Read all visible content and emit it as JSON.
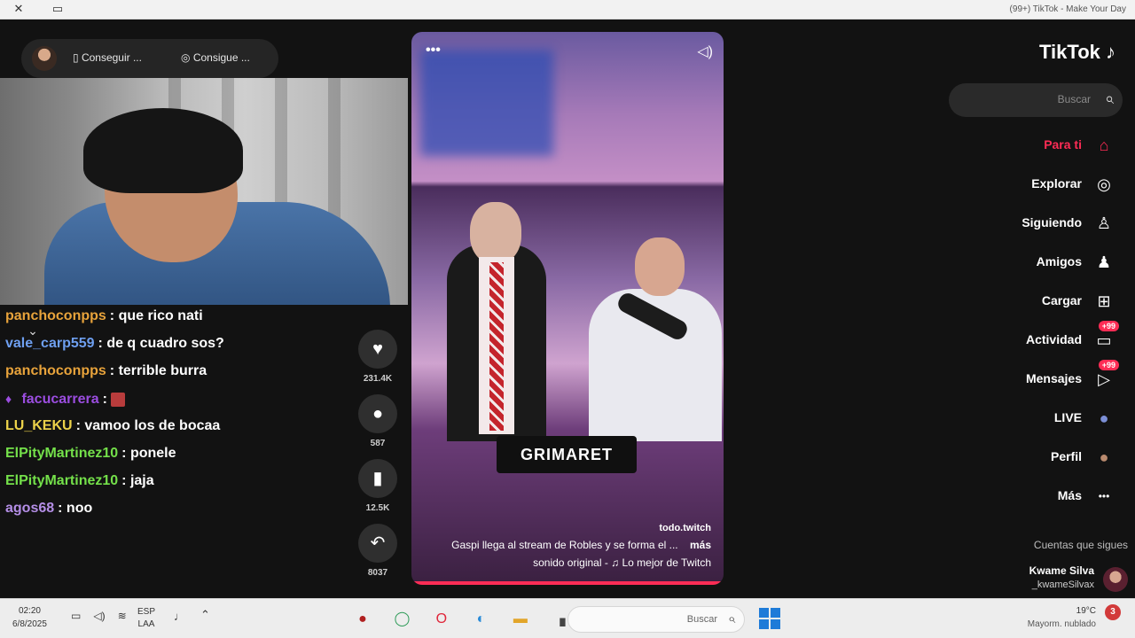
{
  "window": {
    "title": "(99+) TikTok - Make Your Day",
    "close": "✕",
    "restore": "▭"
  },
  "stream_bar": {
    "item1": "Consigue ...",
    "item2": "Conseguir ..."
  },
  "chat": [
    {
      "user": "panchoconpps",
      "color": "#e8a33b",
      "text": "que rico nati"
    },
    {
      "user": "vale_carp559",
      "color": "#6e9ff0",
      "text": "de q cuadro sos?"
    },
    {
      "user": "panchoconpps",
      "color": "#e8a33b",
      "text": "terrible burra"
    },
    {
      "user": "facucarrera",
      "color": "#9b4de0",
      "text": ""
    },
    {
      "user": "LU_KEKU",
      "color": "#ecd24a",
      "text": "vamoo los de bocaa"
    },
    {
      "user": "ElPityMartinez10",
      "color": "#74e04a",
      "text": "ponele"
    },
    {
      "user": "ElPityMartinez10",
      "color": "#74e04a",
      "text": "jaja"
    },
    {
      "user": "agos68",
      "color": "#b48ee6",
      "text": "noo"
    }
  ],
  "actions": {
    "likes": "231.4K",
    "comments": "587",
    "saves": "12.5K",
    "shares": "8037"
  },
  "video": {
    "brand": "GRIMARET",
    "author": "todo.twitch",
    "caption": "Gaspi llega al stream de Robles y se forma el ...",
    "more": "más",
    "sound": "sonido original - ♫ Lo mejor de Twitch"
  },
  "sidebar": {
    "logo": "TikTok",
    "search_placeholder": "Buscar",
    "nav": [
      {
        "label": "Para ti",
        "icon": "home-icon",
        "glyph": "⌂",
        "active": true,
        "badge": ""
      },
      {
        "label": "Explorar",
        "icon": "compass-icon",
        "glyph": "◎",
        "active": false,
        "badge": ""
      },
      {
        "label": "Siguiendo",
        "icon": "following-icon",
        "glyph": "♙",
        "active": false,
        "badge": ""
      },
      {
        "label": "Amigos",
        "icon": "friends-icon",
        "glyph": "♟",
        "active": false,
        "badge": ""
      },
      {
        "label": "Cargar",
        "icon": "upload-icon",
        "glyph": "⊞",
        "active": false,
        "badge": ""
      },
      {
        "label": "Actividad",
        "icon": "activity-icon",
        "glyph": "▭",
        "active": false,
        "badge": "99+"
      },
      {
        "label": "Mensajes",
        "icon": "messages-icon",
        "glyph": "▷",
        "active": false,
        "badge": "99+"
      },
      {
        "label": "LIVE",
        "icon": "live-icon",
        "glyph": "●",
        "active": false,
        "badge": ""
      },
      {
        "label": "Perfil",
        "icon": "profile-icon",
        "glyph": "●",
        "active": false,
        "badge": ""
      },
      {
        "label": "Más",
        "icon": "more-icon",
        "glyph": "•••",
        "active": false,
        "badge": ""
      }
    ],
    "following_header": "Cuentas que sigues",
    "following": {
      "name": "Kwame Silva",
      "username": "kwameSilvax_"
    }
  },
  "taskbar": {
    "time": "02:20",
    "date": "6/8/2025",
    "lang_top": "ESP",
    "lang_bottom": "LAA",
    "search_placeholder": "Buscar",
    "weather_badge": "3",
    "weather_temp": "19°C",
    "weather_desc": "Mayorm. nublado"
  },
  "colors": {
    "accent": "#fe2c55",
    "background": "#121212"
  }
}
